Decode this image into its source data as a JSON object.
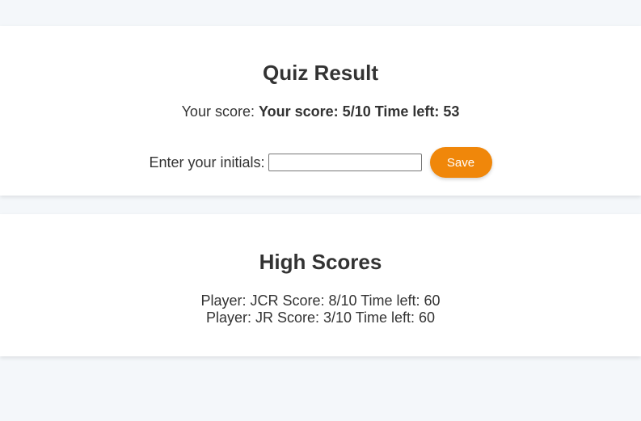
{
  "quiz_result": {
    "title": "Quiz Result",
    "score_prefix": "Your score:",
    "score_value": "Your score: 5/10 Time left: 53",
    "initials_label": "Enter your initials:",
    "initials_value": "",
    "save_label": "Save"
  },
  "high_scores": {
    "title": "High Scores",
    "entries": [
      "Player: JCR Score: 8/10 Time left: 60",
      "Player: JR Score: 3/10 Time left: 60"
    ]
  },
  "colors": {
    "page_background": "#f4f7fa",
    "card_background": "#ffffff",
    "text": "#333333",
    "accent": "#f0870a"
  }
}
